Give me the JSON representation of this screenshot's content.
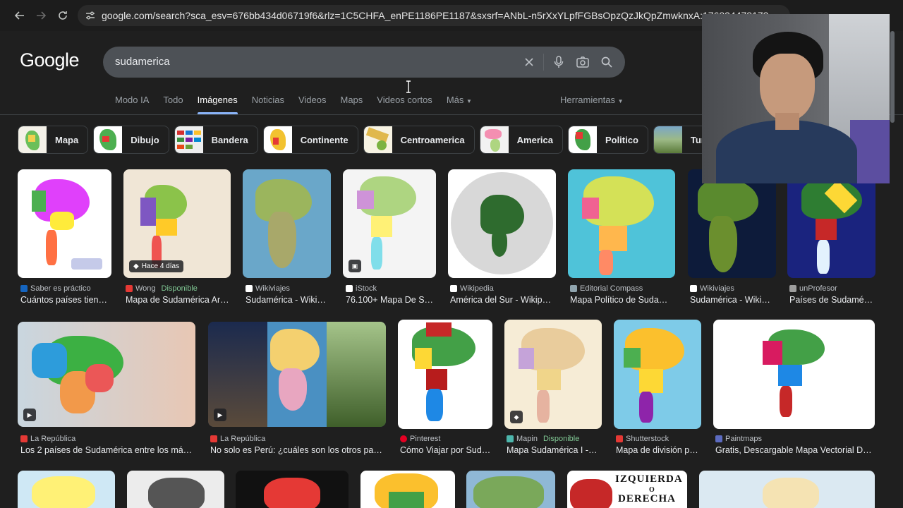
{
  "browser": {
    "url": "google.com/search?sca_esv=676bb434d06719f6&rlz=1C5CHFA_enPE1186PE1187&sxsrf=ANbL-n5rXxYLpfFGBsOpzQzJkQpZmwknxA:176834478173"
  },
  "search": {
    "logo": "Google",
    "query": "sudamerica"
  },
  "tabs": [
    {
      "label": "Modo IA"
    },
    {
      "label": "Todo"
    },
    {
      "label": "Imágenes"
    },
    {
      "label": "Noticias"
    },
    {
      "label": "Videos"
    },
    {
      "label": "Maps"
    },
    {
      "label": "Videos cortos"
    },
    {
      "label": "Más"
    }
  ],
  "tools_label": "Herramientas",
  "chips": [
    {
      "label": "Mapa"
    },
    {
      "label": "Dibujo"
    },
    {
      "label": "Bandera"
    },
    {
      "label": "Continente"
    },
    {
      "label": "Centroamerica"
    },
    {
      "label": "America"
    },
    {
      "label": "Politico"
    },
    {
      "label": "Turismo"
    }
  ],
  "row1": [
    {
      "source": "Saber es práctico",
      "title": "Cuántos países tien…"
    },
    {
      "source": "Wong",
      "availability": "Disponible",
      "title": "Mapa de Sudamérica Ar…",
      "badge": "Hace 4 días"
    },
    {
      "source": "Wikiviajes",
      "title": "Sudamérica - Wiki…"
    },
    {
      "source": "iStock",
      "title": "76.100+ Mapa De S…"
    },
    {
      "source": "Wikipedia",
      "title": "América del Sur - Wikip…"
    },
    {
      "source": "Editorial Compass",
      "title": "Mapa Político de Suda…"
    },
    {
      "source": "Wikiviajes",
      "title": "Sudamérica - Wiki…"
    },
    {
      "source": "unProfesor",
      "title": "Países de Sudamé…"
    }
  ],
  "row2": [
    {
      "source": "La República",
      "title": "Los 2 países de Sudamérica entre los má…"
    },
    {
      "source": "La República",
      "title": "No solo es Perú: ¿cuáles son los otros pa…"
    },
    {
      "source": "Pinterest",
      "title": "Cómo Viajar por Sud…"
    },
    {
      "source": "Mapin",
      "availability": "Disponible",
      "title": "Mapa Sudamérica I -…"
    },
    {
      "source": "Shutterstock",
      "title": "Mapa de división p…"
    },
    {
      "source": "Paintmaps",
      "title": "Gratis, Descargable Mapa Vectorial D…"
    }
  ],
  "row3_text": {
    "izquierda": "IZQUIERDA",
    "o": "O",
    "derecha": "DERECHA"
  },
  "colors": {
    "background": "#1f1f1f",
    "accent": "#8ab4f8",
    "available": "#81c995"
  }
}
